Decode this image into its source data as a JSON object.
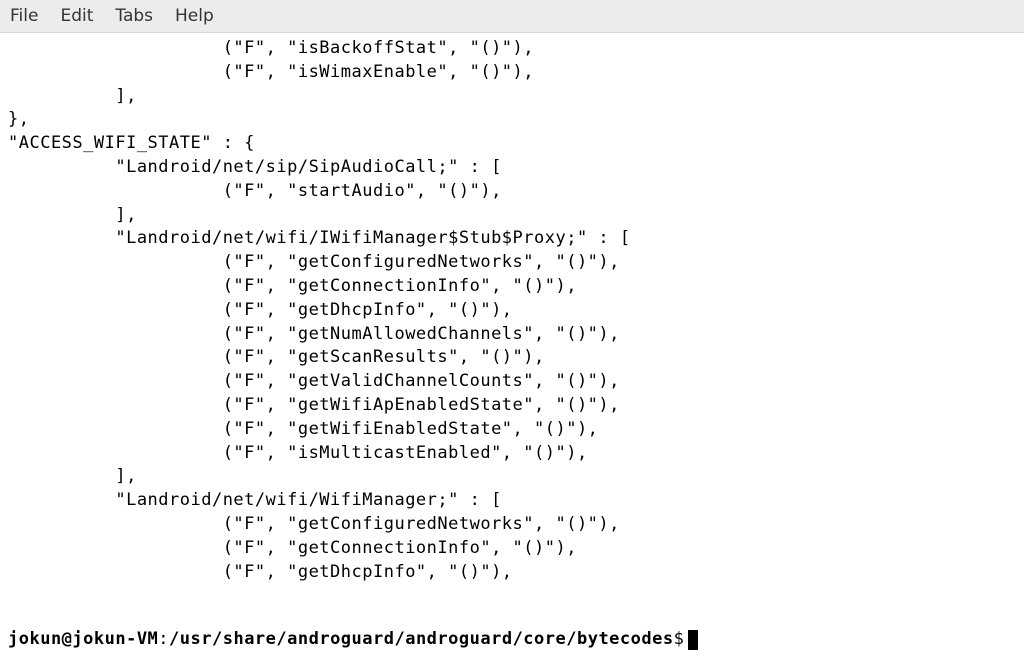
{
  "menu": {
    "file": "File",
    "edit": "Edit",
    "tabs": "Tabs",
    "help": "Help"
  },
  "terminal": {
    "content": "                    (\"F\", \"isBackoffStat\", \"()\"),\n                    (\"F\", \"isWimaxEnable\", \"()\"),\n          ],\n},\n\"ACCESS_WIFI_STATE\" : {\n          \"Landroid/net/sip/SipAudioCall;\" : [\n                    (\"F\", \"startAudio\", \"()\"),\n          ],\n          \"Landroid/net/wifi/IWifiManager$Stub$Proxy;\" : [\n                    (\"F\", \"getConfiguredNetworks\", \"()\"),\n                    (\"F\", \"getConnectionInfo\", \"()\"),\n                    (\"F\", \"getDhcpInfo\", \"()\"),\n                    (\"F\", \"getNumAllowedChannels\", \"()\"),\n                    (\"F\", \"getScanResults\", \"()\"),\n                    (\"F\", \"getValidChannelCounts\", \"()\"),\n                    (\"F\", \"getWifiApEnabledState\", \"()\"),\n                    (\"F\", \"getWifiEnabledState\", \"()\"),\n                    (\"F\", \"isMulticastEnabled\", \"()\"),\n          ],\n          \"Landroid/net/wifi/WifiManager;\" : [\n                    (\"F\", \"getConfiguredNetworks\", \"()\"),\n                    (\"F\", \"getConnectionInfo\", \"()\"),\n                    (\"F\", \"getDhcpInfo\", \"()\"),"
  },
  "prompt": {
    "user": "jokun@jokun-VM",
    "colon": ":",
    "path": "/usr/share/androguard/androguard/core/bytecodes",
    "symbol": "$"
  }
}
